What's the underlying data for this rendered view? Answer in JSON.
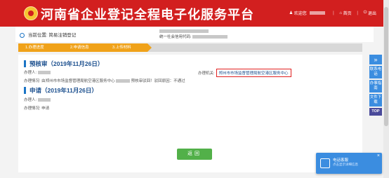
{
  "header": {
    "title": "河南省企业登记全程电子化服务平台",
    "welcome": "欢迎您",
    "home": "首页",
    "logout": "退出"
  },
  "subbar": {
    "location_label": "当前位置: 简易注销登记",
    "company_code_label": "统一社会信用代码:"
  },
  "steps": [
    {
      "label": "1.办理进度"
    },
    {
      "label": "2.申请信息"
    },
    {
      "label": "3.上传材料"
    }
  ],
  "progress": {
    "section1": {
      "title": "预核审（2019年11月26日）",
      "handler_label": "办理人:",
      "office_label": "办理机关:",
      "office": "郑州市市场监督管理局航空港区服务中心",
      "status_label": "办理情况:",
      "status_prefix": "由郑州市市场监督管理局航空港区服务中心",
      "status_suffix": "预核审驳回！驳回原因：不通过"
    },
    "section2": {
      "title": "申请（2019年11月26日）",
      "handler_label": "办理人:",
      "status_label": "办理情况:",
      "status": "申请"
    }
  },
  "buttons": {
    "return": "返回"
  },
  "rightbar": [
    {
      "label": "»",
      "icon": "double-chevron-icon"
    },
    {
      "label": "联系电话"
    },
    {
      "label": "办事指南"
    },
    {
      "label": "文件下载"
    },
    {
      "label": "TOP"
    }
  ],
  "toast": {
    "title": "电话客服",
    "subtitle": "点击显示详细信息"
  }
}
